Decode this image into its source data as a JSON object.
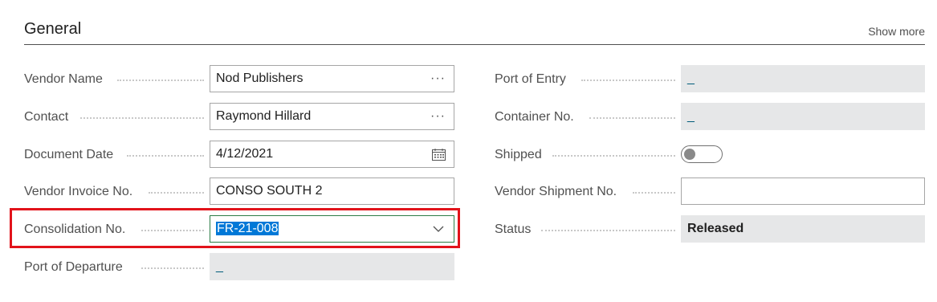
{
  "section": {
    "title": "General",
    "show_more": "Show more"
  },
  "left_fields": {
    "vendor_name": {
      "label": "Vendor Name",
      "value": "Nod Publishers"
    },
    "contact": {
      "label": "Contact",
      "value": "Raymond Hillard"
    },
    "document_date": {
      "label": "Document Date",
      "value": "4/12/2021"
    },
    "vendor_invoice_no": {
      "label": "Vendor Invoice No.",
      "value": "CONSO SOUTH 2"
    },
    "consolidation_no": {
      "label": "Consolidation No.",
      "value": "FR-21-008"
    },
    "port_of_departure": {
      "label": "Port of Departure",
      "value": "_"
    }
  },
  "right_fields": {
    "port_of_entry": {
      "label": "Port of Entry",
      "value": "_"
    },
    "container_no": {
      "label": "Container No.",
      "value": "_"
    },
    "shipped": {
      "label": "Shipped",
      "value": "off"
    },
    "vendor_shipment_no": {
      "label": "Vendor Shipment No.",
      "value": ""
    },
    "status": {
      "label": "Status",
      "value": "Released"
    }
  },
  "icons": {
    "ellipsis": "···",
    "calendar": "calendar-icon",
    "dropdown": "chevron-down-icon"
  },
  "colors": {
    "highlight_border": "#e2131b",
    "selection": "#0078d7",
    "readonly_bg": "#e6e7e8"
  }
}
